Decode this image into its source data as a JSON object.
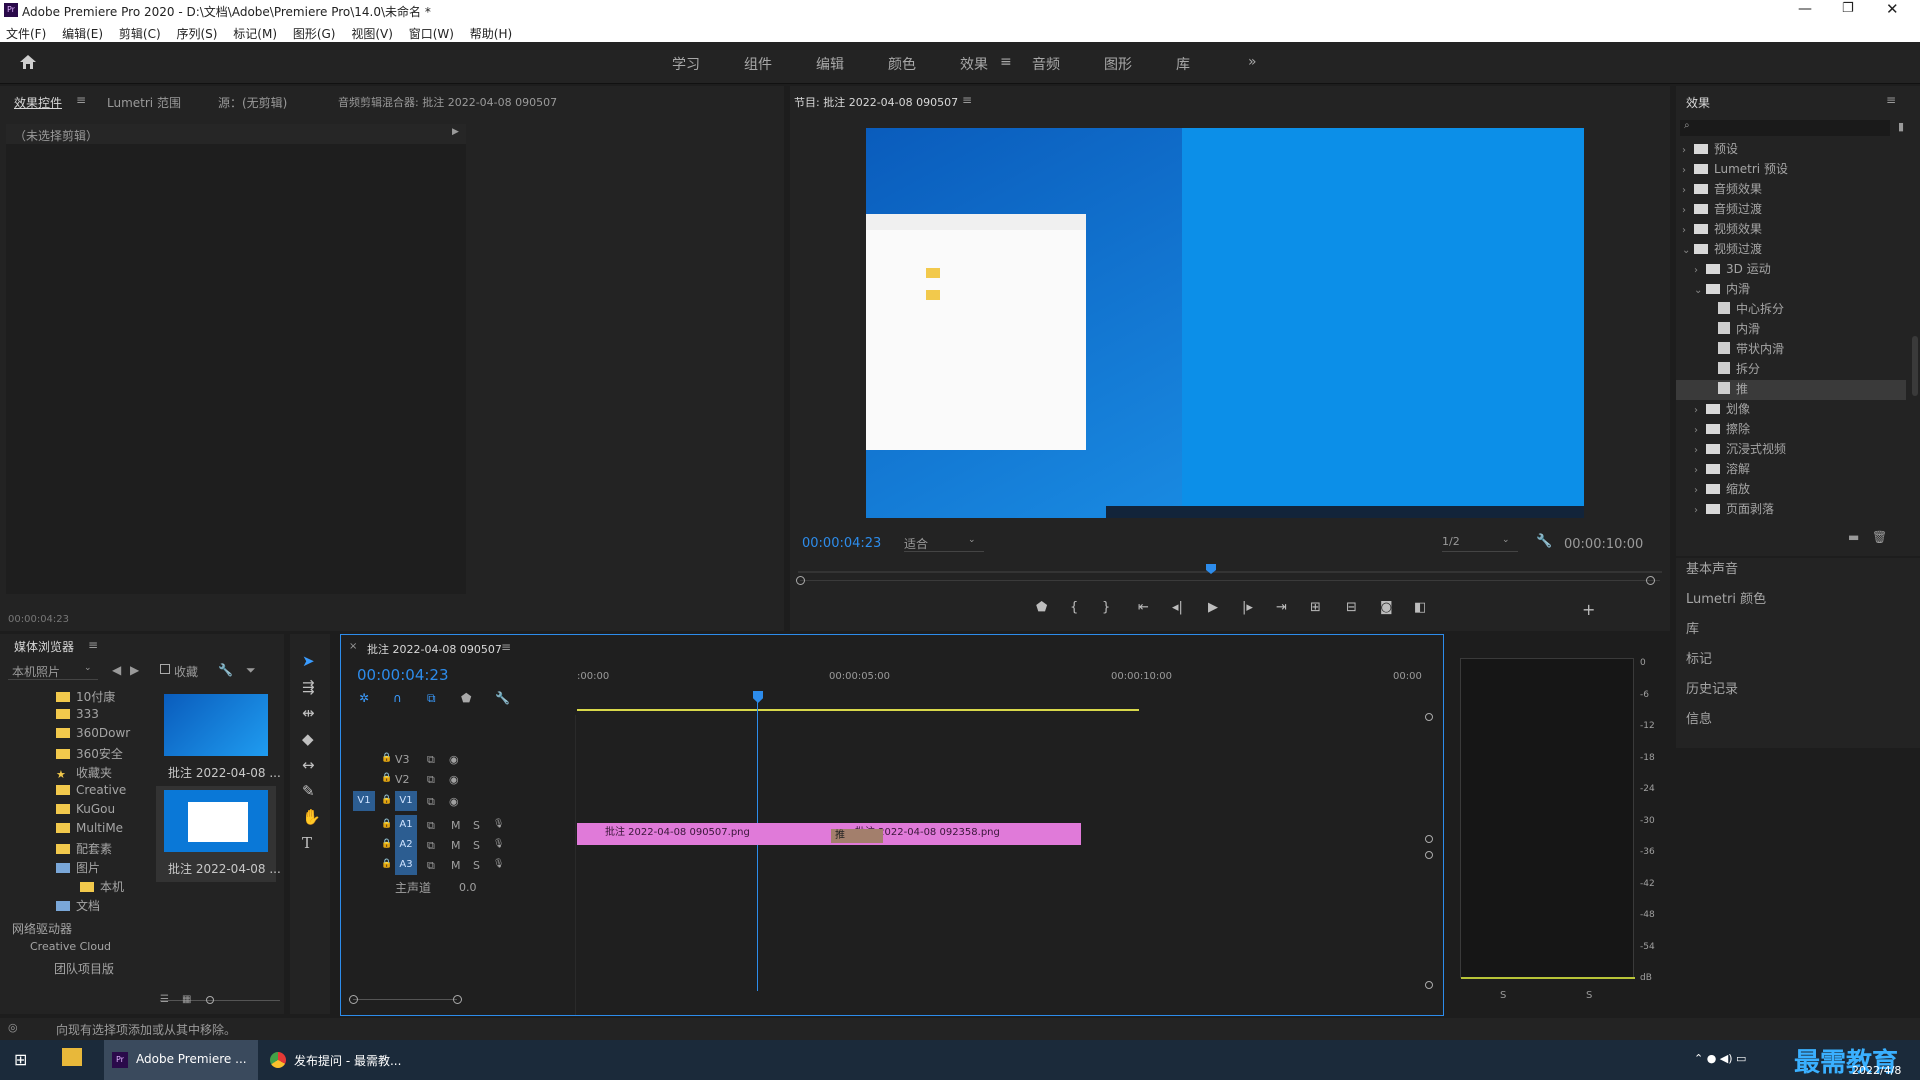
{
  "title_bar": {
    "title": "Adobe Premiere Pro 2020 - D:\\文档\\Adobe\\Premiere Pro\\14.0\\未命名 *"
  },
  "menu": [
    "文件(F)",
    "编辑(E)",
    "剪辑(C)",
    "序列(S)",
    "标记(M)",
    "图形(G)",
    "视图(V)",
    "窗口(W)",
    "帮助(H)"
  ],
  "workspaces": [
    "学习",
    "组件",
    "编辑",
    "颜色",
    "效果",
    "音频",
    "图形",
    "库"
  ],
  "effect_controls": {
    "tabs": [
      "效果控件",
      "Lumetri 范围",
      "源：(无剪辑)",
      "音频剪辑混合器: 批注 2022-04-08 090507"
    ],
    "no_clip": "（未选择剪辑）",
    "timecode": "00:00:04:23"
  },
  "program": {
    "title": "节目: 批注 2022-04-08 090507",
    "timecode": "00:00:04:23",
    "fit": "适合",
    "resolution": "1/2",
    "duration": "00:00:10:00"
  },
  "effects": {
    "title": "效果",
    "tree": [
      {
        "label": "预设",
        "level": 0
      },
      {
        "label": "Lumetri 预设",
        "level": 0
      },
      {
        "label": "音频效果",
        "level": 0
      },
      {
        "label": "音频过渡",
        "level": 0
      },
      {
        "label": "视频效果",
        "level": 0
      },
      {
        "label": "视频过渡",
        "level": 0,
        "open": true
      },
      {
        "label": "3D 运动",
        "level": 1
      },
      {
        "label": "内滑",
        "level": 1,
        "open": true
      },
      {
        "label": "中心拆分",
        "level": 2
      },
      {
        "label": "内滑",
        "level": 2
      },
      {
        "label": "带状内滑",
        "level": 2
      },
      {
        "label": "拆分",
        "level": 2
      },
      {
        "label": "推",
        "level": 2,
        "selected": true
      },
      {
        "label": "划像",
        "level": 1
      },
      {
        "label": "擦除",
        "level": 1
      },
      {
        "label": "沉浸式视频",
        "level": 1
      },
      {
        "label": "溶解",
        "level": 1
      },
      {
        "label": "缩放",
        "level": 1
      },
      {
        "label": "页面剥落",
        "level": 1
      }
    ]
  },
  "right_panels": [
    "基本声音",
    "Lumetri 颜色",
    "库",
    "标记",
    "历史记录",
    "信息"
  ],
  "media_browser": {
    "title": "媒体浏览器",
    "location": "本机照片",
    "favorites": "收藏",
    "tree": [
      "10付康",
      "333",
      "360Dowr",
      "360安全",
      "收藏夹",
      "Creative",
      "KuGou",
      "MultiMe",
      "配套素",
      "图片",
      "本机",
      "文档"
    ],
    "network": "网络驱动器",
    "cloud": "Creative Cloud",
    "team": "团队项目版",
    "thumbs": [
      "批注 2022-04-08 ...",
      "批注 2022-04-08 ..."
    ]
  },
  "timeline": {
    "title": "批注 2022-04-08 090507",
    "timecode": "00:00:04:23",
    "ruler": [
      ":00:00",
      "00:00:05:00",
      "00:00:10:00",
      "00:00"
    ],
    "video_tracks": [
      "V3",
      "V2",
      "V1"
    ],
    "audio_tracks": [
      "A1",
      "A2",
      "A3"
    ],
    "source_v": "V1",
    "master": "主声道",
    "master_val": "0.0",
    "clips": [
      "批注 2022-04-08 090507.png",
      "批注 2022-04-08 092358.png"
    ],
    "transition": "推"
  },
  "meter": {
    "scale": [
      "0",
      "-6",
      "-12",
      "-18",
      "-24",
      "-30",
      "-36",
      "-42",
      "-48",
      "-54",
      "dB"
    ],
    "solo": [
      "S",
      "S"
    ]
  },
  "status": "向现有选择项添加或从其中移除。",
  "taskbar": {
    "apps": [
      "Adobe Premiere ...",
      "发布提问 - 最需教..."
    ],
    "date": "2022/4/8",
    "watermark": "最需教育"
  },
  "colors": {
    "accent": "#2d8ceb",
    "clip": "#e07ad9",
    "desktop": "#0a78d7"
  }
}
